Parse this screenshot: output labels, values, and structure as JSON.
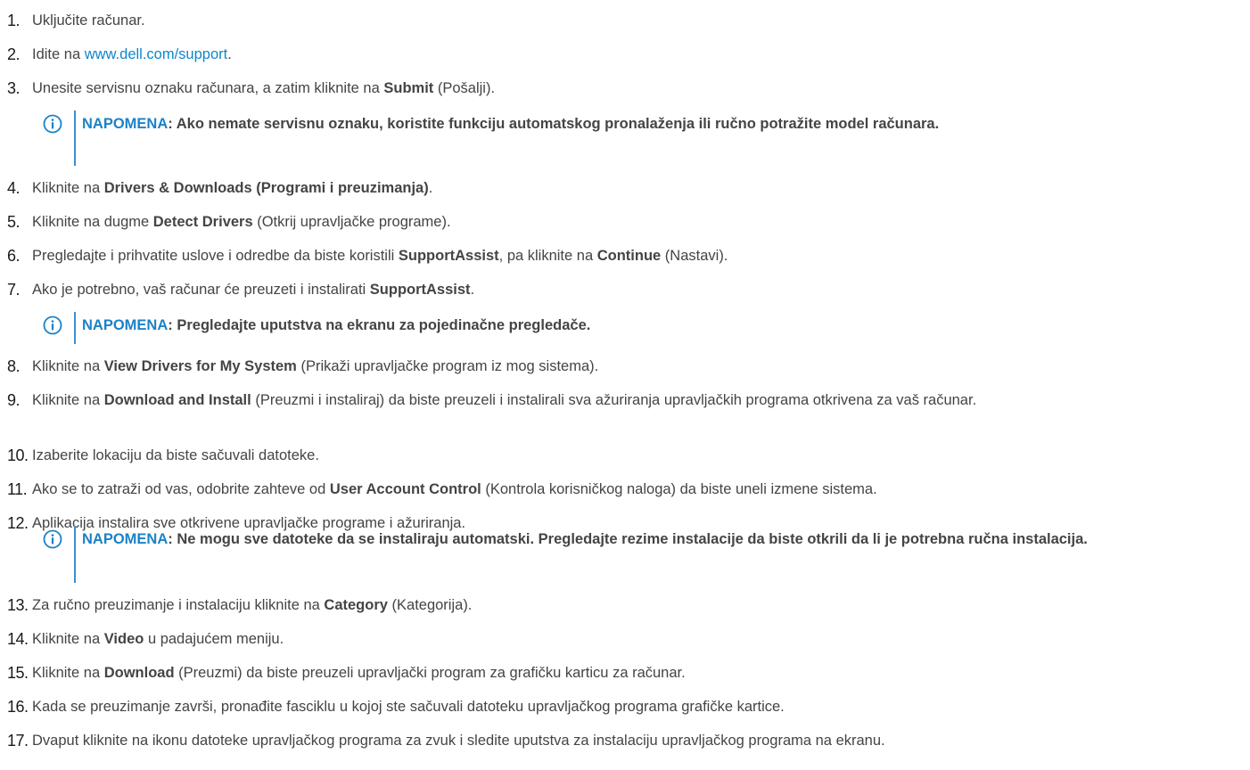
{
  "steps": [
    {
      "num": "1.",
      "segments": [
        {
          "t": "Uključite računar."
        }
      ]
    },
    {
      "num": "2.",
      "segments": [
        {
          "t": "Idite na "
        },
        {
          "t": "www.dell.com/support",
          "link": true
        },
        {
          "t": "."
        }
      ]
    },
    {
      "num": "3.",
      "segments": [
        {
          "t": "Unesite servisnu oznaku računara, a zatim kliknite na "
        },
        {
          "t": "Submit",
          "b": true
        },
        {
          "t": " (Pošalji)."
        }
      ]
    },
    {
      "num": "4.",
      "segments": [
        {
          "t": "Kliknite na "
        },
        {
          "t": "Drivers & Downloads (Programi i preuzimanja)",
          "b": true
        },
        {
          "t": "."
        }
      ]
    },
    {
      "num": "5.",
      "segments": [
        {
          "t": "Kliknite na dugme "
        },
        {
          "t": "Detect Drivers",
          "b": true
        },
        {
          "t": " (Otkrij upravljačke programe)."
        }
      ]
    },
    {
      "num": "6.",
      "segments": [
        {
          "t": "Pregledajte i prihvatite uslove i odredbe da biste koristili "
        },
        {
          "t": "SupportAssist",
          "b": true
        },
        {
          "t": ", pa kliknite na "
        },
        {
          "t": "Continue",
          "b": true
        },
        {
          "t": " (Nastavi)."
        }
      ]
    },
    {
      "num": "7.",
      "segments": [
        {
          "t": "Ako je potrebno, vaš računar će preuzeti i instalirati "
        },
        {
          "t": "SupportAssist",
          "b": true
        },
        {
          "t": "."
        }
      ]
    },
    {
      "num": "8.",
      "segments": [
        {
          "t": "Kliknite na "
        },
        {
          "t": "View Drivers for My System",
          "b": true
        },
        {
          "t": " (Prikaži upravljačke program iz mog sistema)."
        }
      ]
    },
    {
      "num": "9.",
      "segments": [
        {
          "t": "Kliknite na "
        },
        {
          "t": "Download and Install",
          "b": true
        },
        {
          "t": " (Preuzmi i instaliraj) da biste preuzeli i instalirali sva ažuriranja upravljačkih programa otkrivena za vaš računar."
        }
      ]
    },
    {
      "num": "10.",
      "segments": [
        {
          "t": "Izaberite lokaciju da biste sačuvali datoteke."
        }
      ]
    },
    {
      "num": "11.",
      "segments": [
        {
          "t": "Ako se to zatraži od vas, odobrite zahteve od "
        },
        {
          "t": "User Account Control",
          "b": true
        },
        {
          "t": " (Kontrola korisničkog naloga) da biste uneli izmene sistema."
        }
      ]
    },
    {
      "num": "12.",
      "segments": [
        {
          "t": "Aplikacija instalira sve otkrivene upravljačke programe i ažuriranja."
        }
      ]
    },
    {
      "num": "13.",
      "segments": [
        {
          "t": "Za ručno preuzimanje i instalaciju kliknite na "
        },
        {
          "t": "Category",
          "b": true
        },
        {
          "t": " (Kategorija)."
        }
      ]
    },
    {
      "num": "14.",
      "segments": [
        {
          "t": "Kliknite na "
        },
        {
          "t": "Video",
          "b": true
        },
        {
          "t": " u padajućem meniju."
        }
      ]
    },
    {
      "num": "15.",
      "segments": [
        {
          "t": "Kliknite na "
        },
        {
          "t": "Download",
          "b": true
        },
        {
          "t": " (Preuzmi) da biste preuzeli upravljački program za grafičku karticu za računar."
        }
      ]
    },
    {
      "num": "16.",
      "segments": [
        {
          "t": "Kada se preuzimanje završi, pronađite fasciklu u kojoj ste sačuvali datoteku upravljačkog programa grafičke kartice."
        }
      ]
    },
    {
      "num": "17.",
      "segments": [
        {
          "t": "Dvaput kliknite na ikonu datoteke upravljačkog programa za zvuk i sledite uputstva za instalaciju upravljačkog programa na ekranu."
        }
      ]
    }
  ],
  "notes": [
    {
      "label": "NAPOMENA",
      "text": ": Ako nemate servisnu oznaku, koristite funkciju automatskog pronalaženja ili ručno potražite model računara."
    },
    {
      "label": "NAPOMENA",
      "text": ": Pregledajte uputstva na ekranu za pojedinačne pregledače."
    },
    {
      "label": "NAPOMENA",
      "text": ": Ne mogu sve datoteke da se instaliraju automatski. Pregledajte rezime instalacije da biste otkrili da li je potrebna ručna instalacija."
    }
  ],
  "colors": {
    "link": "#0d86cc",
    "note_label": "#1a82c8",
    "note_bar": "#3b8fd0",
    "icon": "#1a82c8"
  },
  "note_icon": "info-circle-icon"
}
